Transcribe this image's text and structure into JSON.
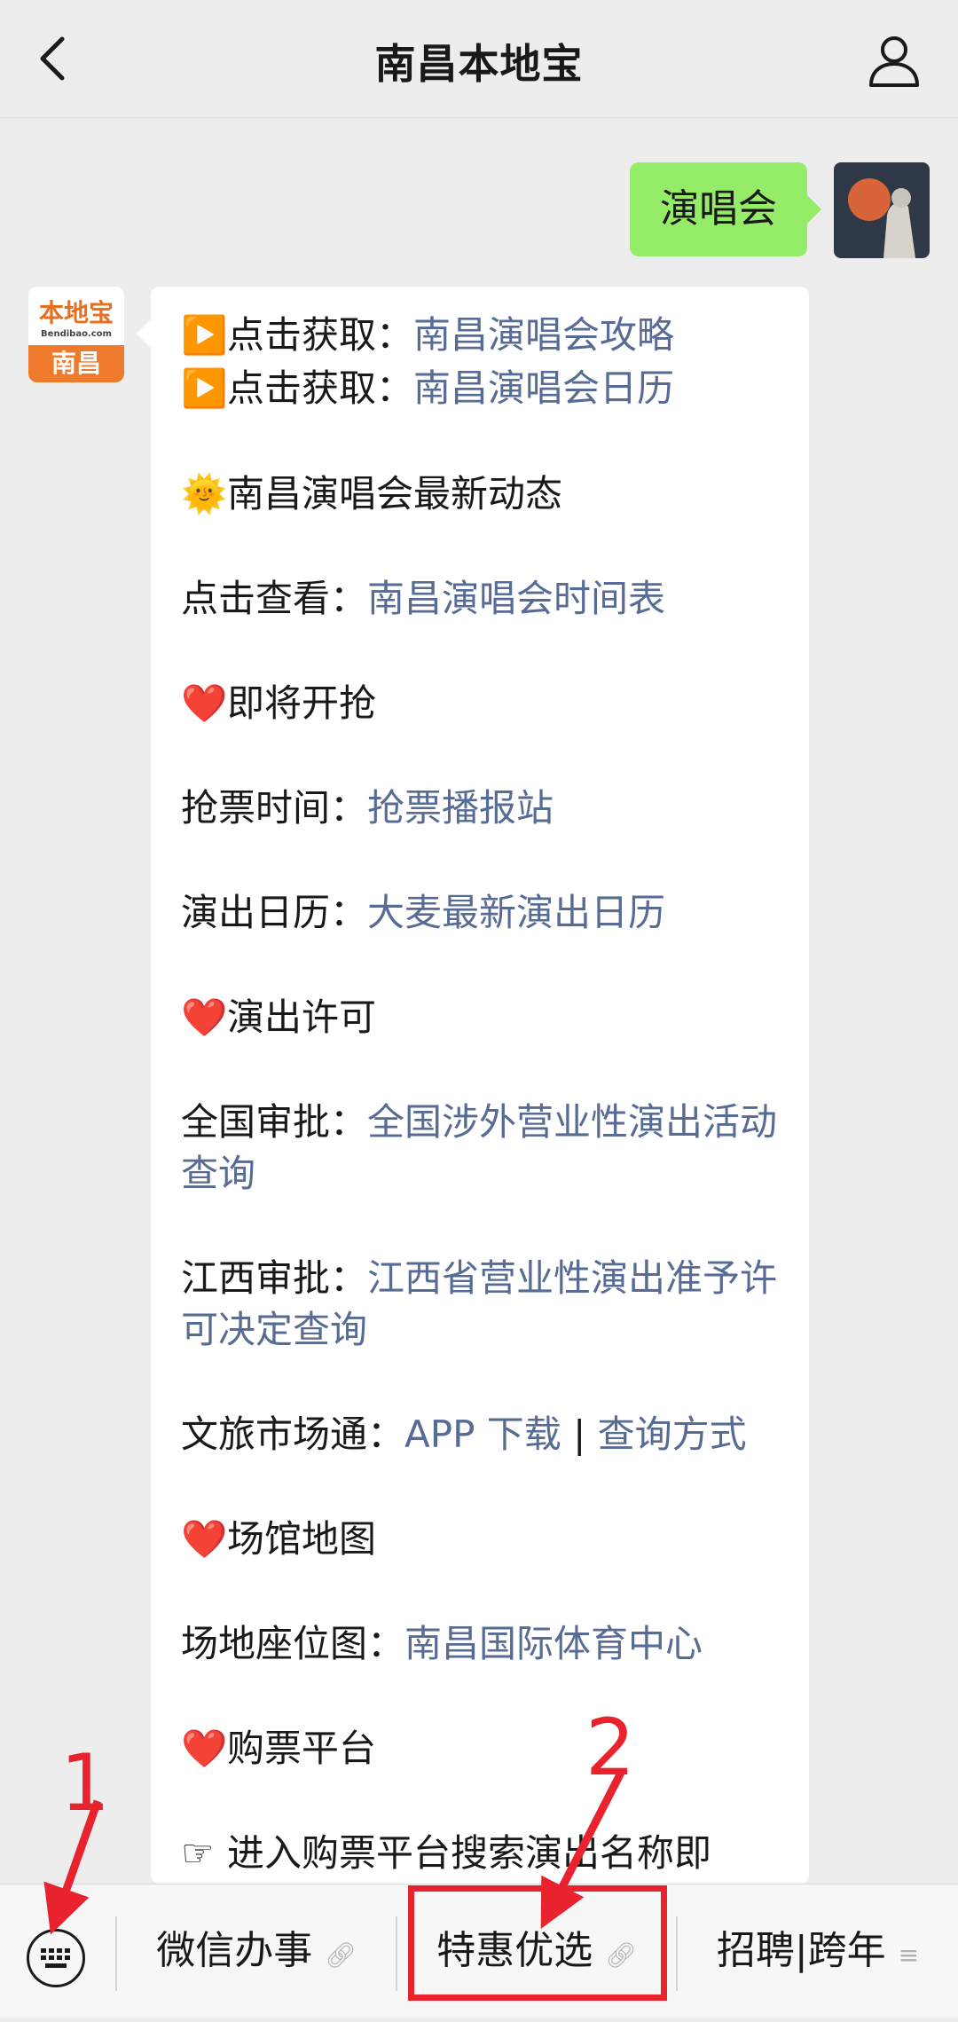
{
  "header": {
    "title": "南昌本地宝"
  },
  "outgoing_message": {
    "text": "演唱会"
  },
  "bot_avatar": {
    "brand": "本地宝",
    "domain": "Bendibao.com",
    "city": "南昌"
  },
  "reply": {
    "l1": {
      "emoji": "▶️",
      "prefix": "点击获取：",
      "link": "南昌演唱会攻略"
    },
    "l2": {
      "emoji": "▶️",
      "prefix": "点击获取：",
      "link": "南昌演唱会日历"
    },
    "l3": {
      "emoji": "🌞",
      "text": "南昌演唱会最新动态"
    },
    "l4": {
      "prefix": "点击查看：",
      "link": "南昌演唱会时间表"
    },
    "l5": {
      "emoji": "❤️",
      "text": "即将开抢"
    },
    "l6": {
      "prefix": "抢票时间：",
      "link": "抢票播报站"
    },
    "l7": {
      "prefix": "演出日历：",
      "link": "大麦最新演出日历"
    },
    "l8": {
      "emoji": "❤️",
      "text": "演出许可"
    },
    "l9": {
      "prefix": "全国审批：",
      "link": "全国涉外营业性演出活动查询"
    },
    "l10": {
      "prefix": "江西审批：",
      "link": "江西省营业性演出准予许可决定查询"
    },
    "l11": {
      "prefix": "文旅市场通：",
      "link1": "APP 下载",
      "separator": "|",
      "link2": "查询方式"
    },
    "l12": {
      "emoji": "❤️",
      "text": "场馆地图"
    },
    "l13": {
      "prefix": "场地座位图：",
      "link": "南昌国际体育中心"
    },
    "l14": {
      "emoji": "❤️",
      "text": "购票平台"
    },
    "l15": {
      "emoji": "☞",
      "text": "进入购票平台搜索演出名称即"
    }
  },
  "bottom_menu": {
    "item1": "微信办事",
    "item2": "特惠优选",
    "item3": "招聘|跨年"
  },
  "annotations": {
    "n1": "1",
    "n2": "2"
  },
  "colors": {
    "link": "#576b95",
    "outgoing_bubble": "#95ec69",
    "annotation": "#e8232e"
  }
}
